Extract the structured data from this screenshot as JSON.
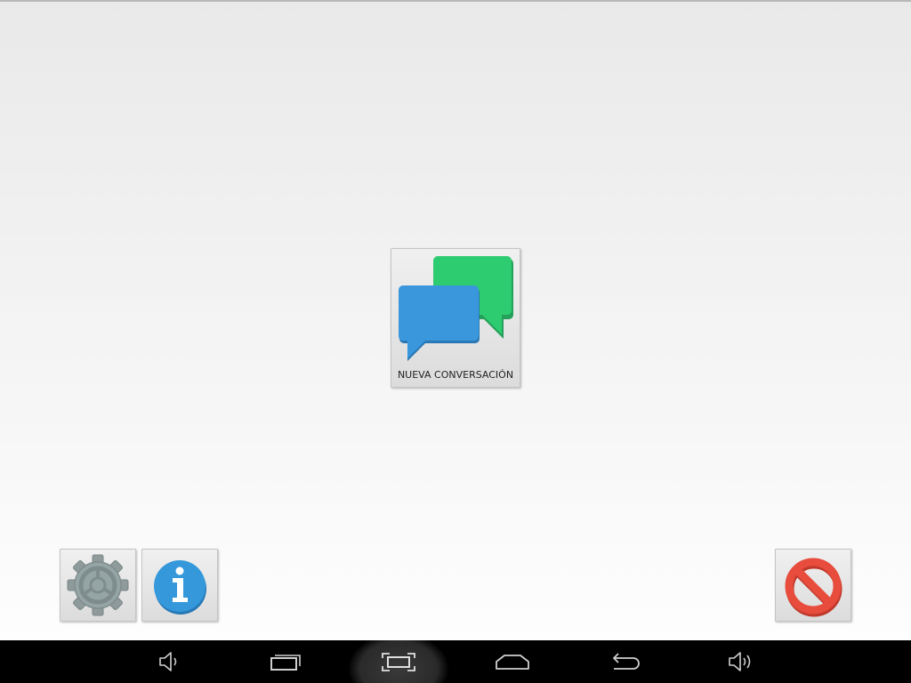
{
  "main": {
    "new_conversation_label": "NUEVA CONVERSACIÓN"
  },
  "icons": {
    "new_conversation": "chat-bubbles-icon",
    "settings": "gear-icon",
    "info": "info-icon",
    "exit": "no-entry-icon"
  },
  "navbar": {
    "buttons": [
      "volume-down",
      "recent-apps",
      "screenshot",
      "home",
      "back",
      "volume-up"
    ]
  },
  "colors": {
    "bubble_blue": "#3a97dc",
    "bubble_green": "#2ecc71",
    "info_blue": "#3498db",
    "gear_gray": "#8f9a9b",
    "stop_red": "#e74c3c",
    "navbar_bg": "#000000"
  }
}
